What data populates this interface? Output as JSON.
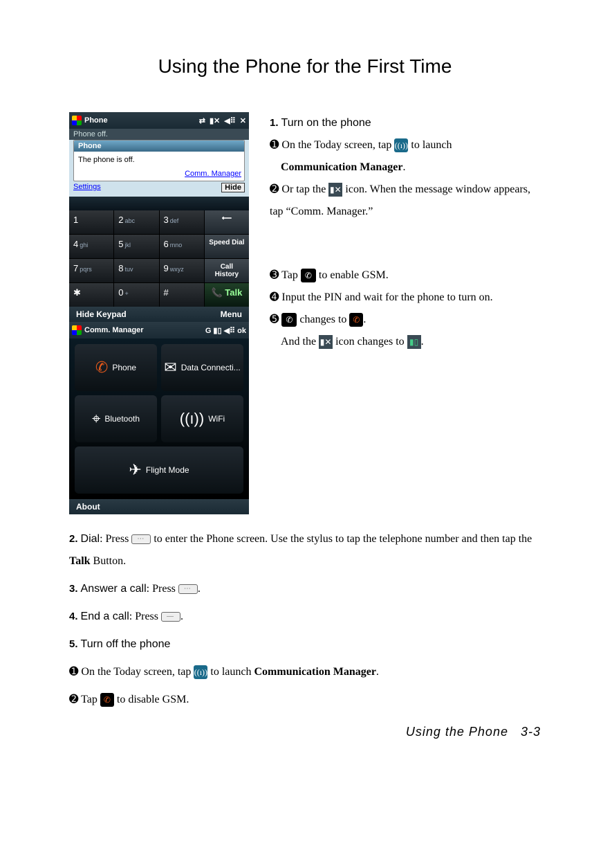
{
  "title": "Using the Phone for the First Time",
  "screens": {
    "phone": {
      "titlebar_label": "Phone",
      "status_line": "Phone off.",
      "popup_title": "Phone",
      "popup_msg": "The phone is off.",
      "popup_link": "Comm. Manager",
      "settings_label": "Settings",
      "hide_btn": "Hide",
      "keys": {
        "k1": "1",
        "k2": "2",
        "k2s": "abc",
        "k3": "3",
        "k3s": "def",
        "k4": "4",
        "k4s": "ghi",
        "k5": "5",
        "k5s": "jkl",
        "k6": "6",
        "k6s": "mno",
        "k7": "7",
        "k7s": "pqrs",
        "k8": "8",
        "k8s": "tuv",
        "k9": "9",
        "k9s": "wxyz",
        "kstar": "✱",
        "k0": "0",
        "k0s": "+",
        "khash": "#",
        "back": "⟵",
        "speed": "Speed Dial",
        "hist": "Call History",
        "talk": "Talk"
      },
      "bottom_left": "Hide Keypad",
      "bottom_right": "Menu"
    },
    "cm": {
      "titlebar_label": "Comm. Manager",
      "status_icons": "G  ▮▯ ◀⠿  ok",
      "tiles": {
        "phone": "Phone",
        "data": "Data Connecti...",
        "bt": "Bluetooth",
        "wifi": "WiFi",
        "flight": "Flight Mode"
      },
      "about": "About"
    }
  },
  "section1": {
    "heading": "Turn on the phone",
    "s1a": "On the Today screen, tap ",
    "s1b": " to launch ",
    "s1c": "Communication Manager",
    "s1d": ".",
    "s2a": "Or tap the ",
    "s2b": " icon. When the message window appears, tap “Comm. Manager.”",
    "s3a": "Tap ",
    "s3b": " to enable GSM.",
    "s4": "Input the PIN and wait for the phone to turn on.",
    "s5a": " changes to ",
    "s5b": ".",
    "s5c": "And the ",
    "s5d": " icon changes to ",
    "s5e": "."
  },
  "section2": {
    "heading": "Dial",
    "a": ": Press ",
    "b": " to enter the Phone screen. Use the stylus to tap the telephone number and then tap the ",
    "c": "Talk",
    "d": " Button."
  },
  "section3": {
    "heading": "Answer a call",
    "a": ": Press ",
    "b": "."
  },
  "section4": {
    "heading": "End a call",
    "a": ": Press ",
    "b": "."
  },
  "section5": {
    "heading": "Turn off the phone",
    "s1a": "On the Today screen, tap ",
    "s1b": " to launch ",
    "s1c": "Communication Manager",
    "s1d": ".",
    "s2a": "Tap ",
    "s2b": " to disable GSM."
  },
  "footer": {
    "label": "Using  the  Phone",
    "page": "3-3"
  },
  "bullets": {
    "b1": "➊",
    "b2": "➋",
    "b3": "➌",
    "b4": "➍",
    "b5": "➎"
  },
  "nums": {
    "n1": "1.",
    "n2": "2.",
    "n3": "3.",
    "n4": "4.",
    "n5": "5."
  }
}
